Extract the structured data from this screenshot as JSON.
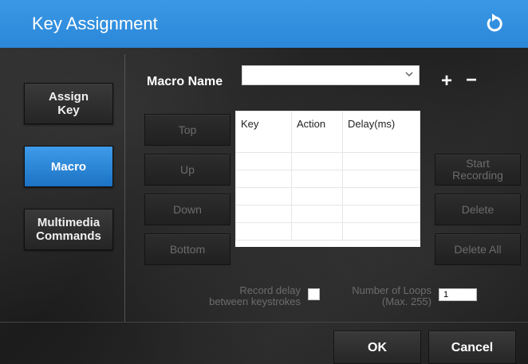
{
  "window": {
    "title": "Key Assignment",
    "refresh_icon": "refresh-icon",
    "accent": "#2f8fe0"
  },
  "sidebar": {
    "items": [
      {
        "label": "Assign\nKey",
        "active": false
      },
      {
        "label": "Macro",
        "active": true
      },
      {
        "label": "Multimedia\nCommands",
        "active": false
      }
    ]
  },
  "macro": {
    "name_label": "Macro Name",
    "name_value": "",
    "plus": "+",
    "minus": "−"
  },
  "move_buttons": {
    "top": "Top",
    "up": "Up",
    "down": "Down",
    "bottom": "Bottom"
  },
  "table": {
    "columns": [
      "Key",
      "Action",
      "Delay(ms)"
    ],
    "rows": []
  },
  "right_buttons": {
    "start": "Start\nRecording",
    "delete": "Delete",
    "delete_all": "Delete All"
  },
  "options": {
    "record_delay_label": "Record delay\nbetween keystrokes",
    "record_delay_checked": false,
    "loops_label": "Number of Loops\n(Max. 255)",
    "loops_value": "1"
  },
  "footer": {
    "ok": "OK",
    "cancel": "Cancel"
  }
}
